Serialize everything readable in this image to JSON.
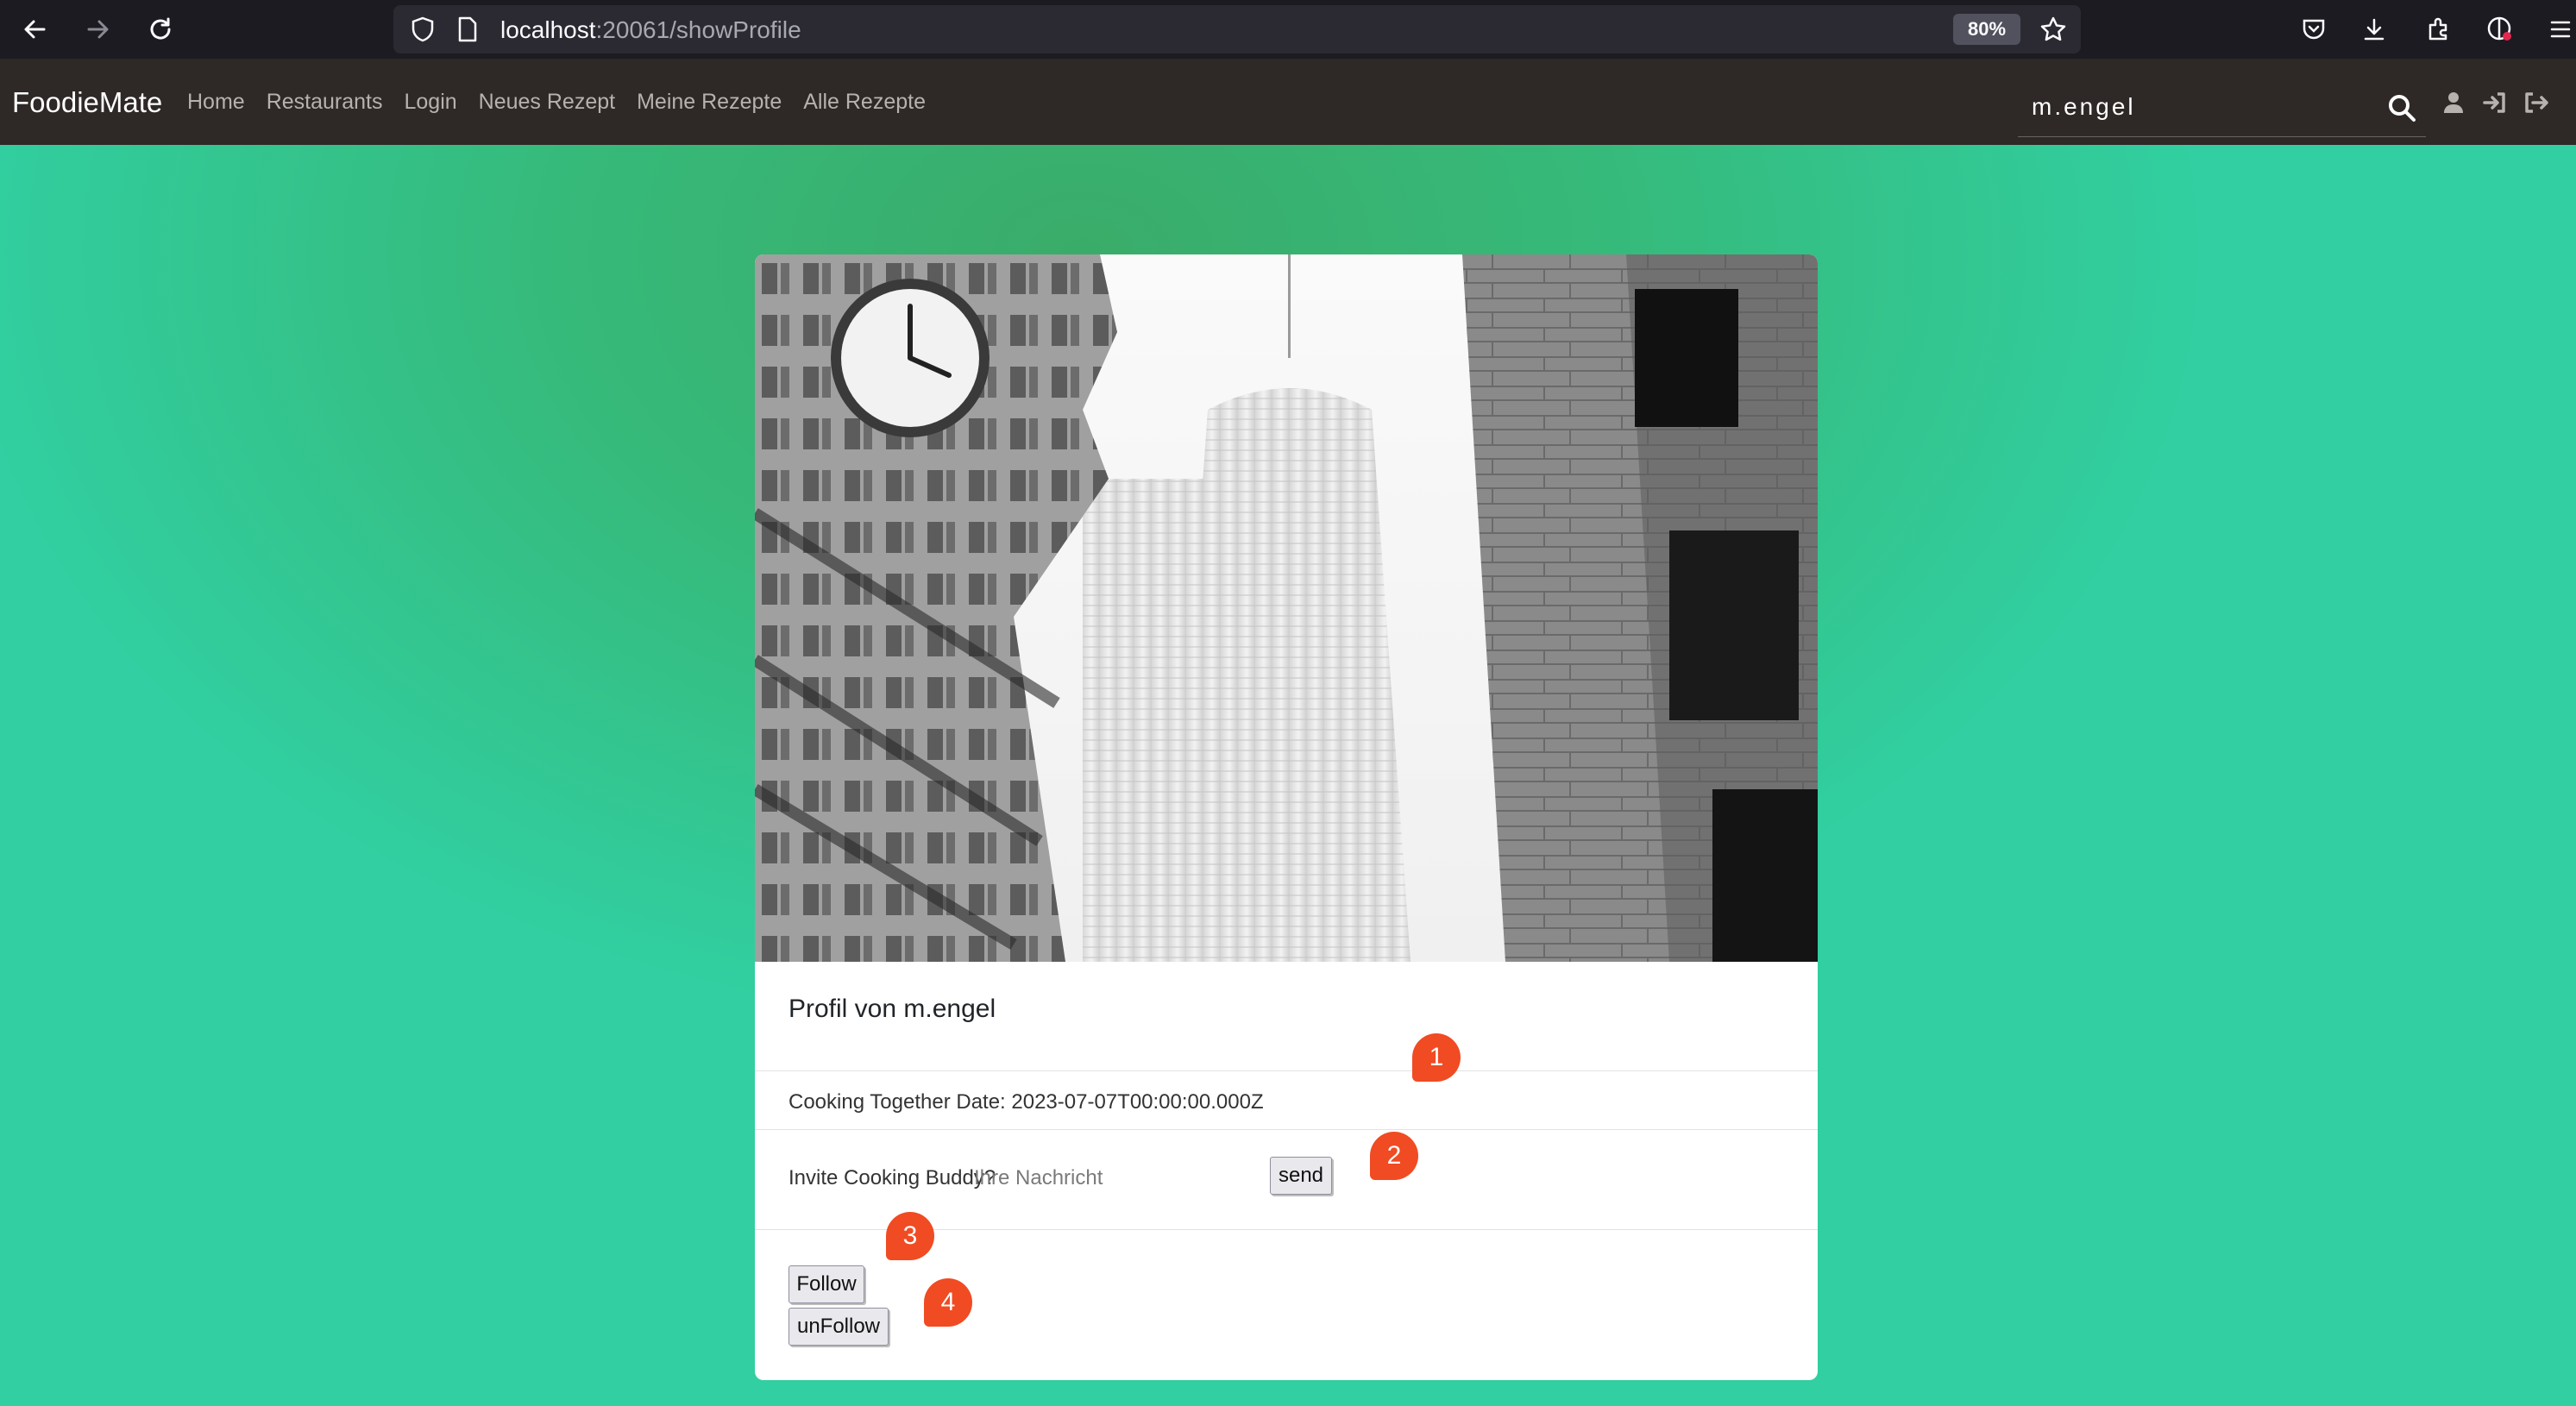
{
  "browser": {
    "url_host": "localhost",
    "url_rest": ":20061/showProfile",
    "zoom": "80%"
  },
  "navbar": {
    "brand": "FoodieMate",
    "links": [
      "Home",
      "Restaurants",
      "Login",
      "Neues Rezept",
      "Meine Rezepte",
      "Alle Rezepte"
    ],
    "search_value": "m.engel"
  },
  "profile": {
    "title": "Profil von m.engel",
    "cooking_date_text": "Cooking Together Date: 2023-07-07T00:00:00.000Z",
    "invite_label": "Invite Cooking Buddy?",
    "message_placeholder": "Ihre Nachricht",
    "send_label": "send",
    "follow_label": "Follow",
    "unfollow_label": "unFollow"
  },
  "markers": [
    "1",
    "2",
    "3",
    "4"
  ],
  "colors": {
    "marker": "#f04b23",
    "navbar": "#2e2826",
    "background_green": "#36b979"
  }
}
